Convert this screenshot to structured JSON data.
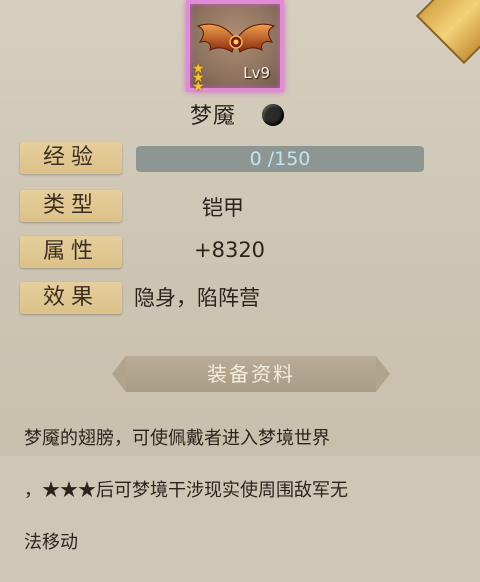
{
  "item": {
    "level": "Lv9",
    "name": "梦魇",
    "star_count": 3,
    "quality_color": "#2b2a28",
    "frame_color": "#e38bd7",
    "icon": "bat-wings-icon"
  },
  "stats": {
    "exp_label": "经验",
    "exp_text": "0  /150",
    "exp_current": 0,
    "exp_max": 150,
    "type_label": "类型",
    "type_value": "铠甲",
    "attr_label": "属性",
    "attr_value": "+8320",
    "effect_label": "效果",
    "effect_value": "隐身，陷阵营"
  },
  "info": {
    "header": "装备资料",
    "description_line1": "梦魇的翅膀，可使佩戴者进入梦境世界",
    "description_line2": "，★★★后可梦境干涉现实使周围敌军无",
    "description_line3": "法移动"
  }
}
